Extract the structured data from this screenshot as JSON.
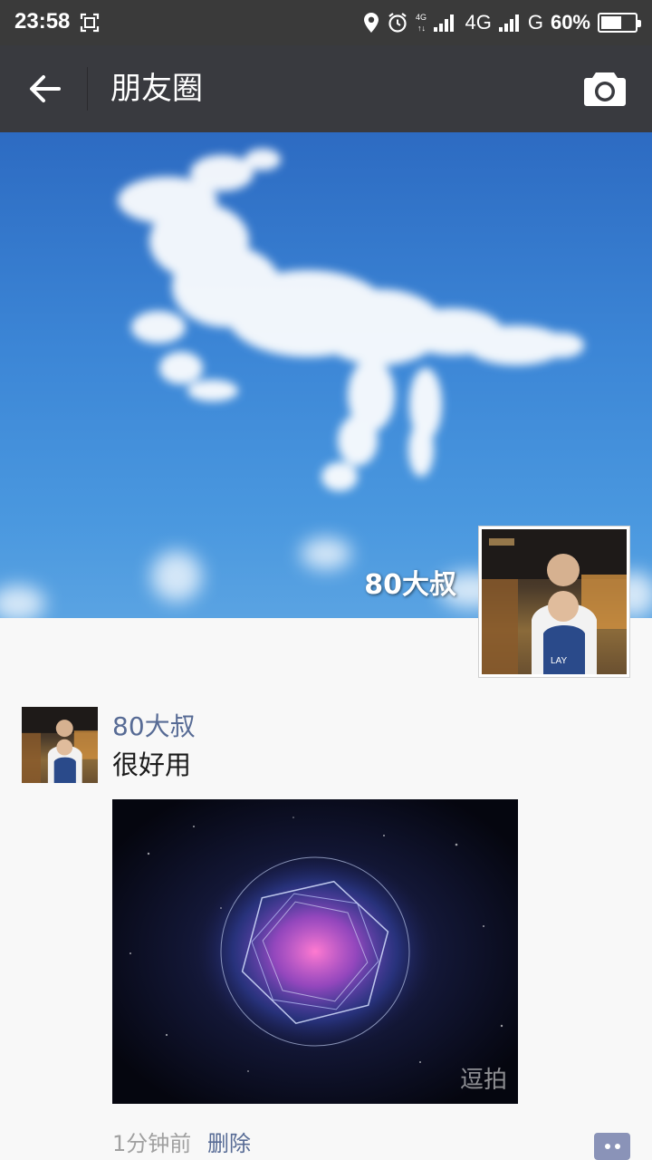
{
  "status_bar": {
    "time": "23:58",
    "network_1": "4G",
    "network_2": "G",
    "battery": "60%",
    "battery_level": 0.6
  },
  "nav": {
    "title": "朋友圈"
  },
  "cover": {
    "name": "80大叔"
  },
  "post": {
    "author": "80大叔",
    "text": "很好用",
    "image_watermark": "逗拍",
    "time": "1分钟前",
    "delete_label": "删除"
  },
  "icons": {
    "back": "arrow-left-icon",
    "camera": "camera-icon",
    "location": "location-icon",
    "alarm": "alarm-icon",
    "signal": "signal-icon",
    "screenshot": "screenshot-icon",
    "more": "more-icon"
  },
  "colors": {
    "nav_bg": "#393a3f",
    "link": "#576b95",
    "page_bg": "#f8f8f8"
  }
}
